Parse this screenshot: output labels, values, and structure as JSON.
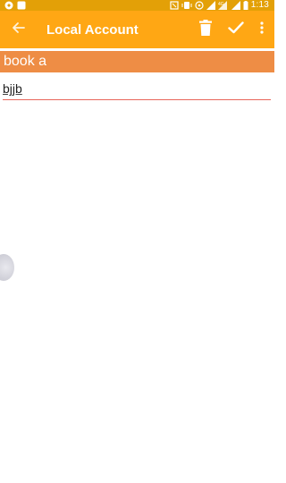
{
  "status_bar": {
    "time": "1:13",
    "left_icons": [
      "cast-icon",
      "notification-icon"
    ],
    "right_icons": [
      "nfc-icon",
      "vibrate-icon",
      "hotspot-icon",
      "signal-icon",
      "4g-icon",
      "signal-icon-2",
      "battery-icon"
    ]
  },
  "app_bar": {
    "title": "Local Account",
    "background": "#ffa714",
    "actions": [
      "delete-icon",
      "check-icon",
      "overflow-menu-icon"
    ]
  },
  "note": {
    "title": "book a",
    "title_background": "#ee8d45",
    "body": "bjjb"
  }
}
